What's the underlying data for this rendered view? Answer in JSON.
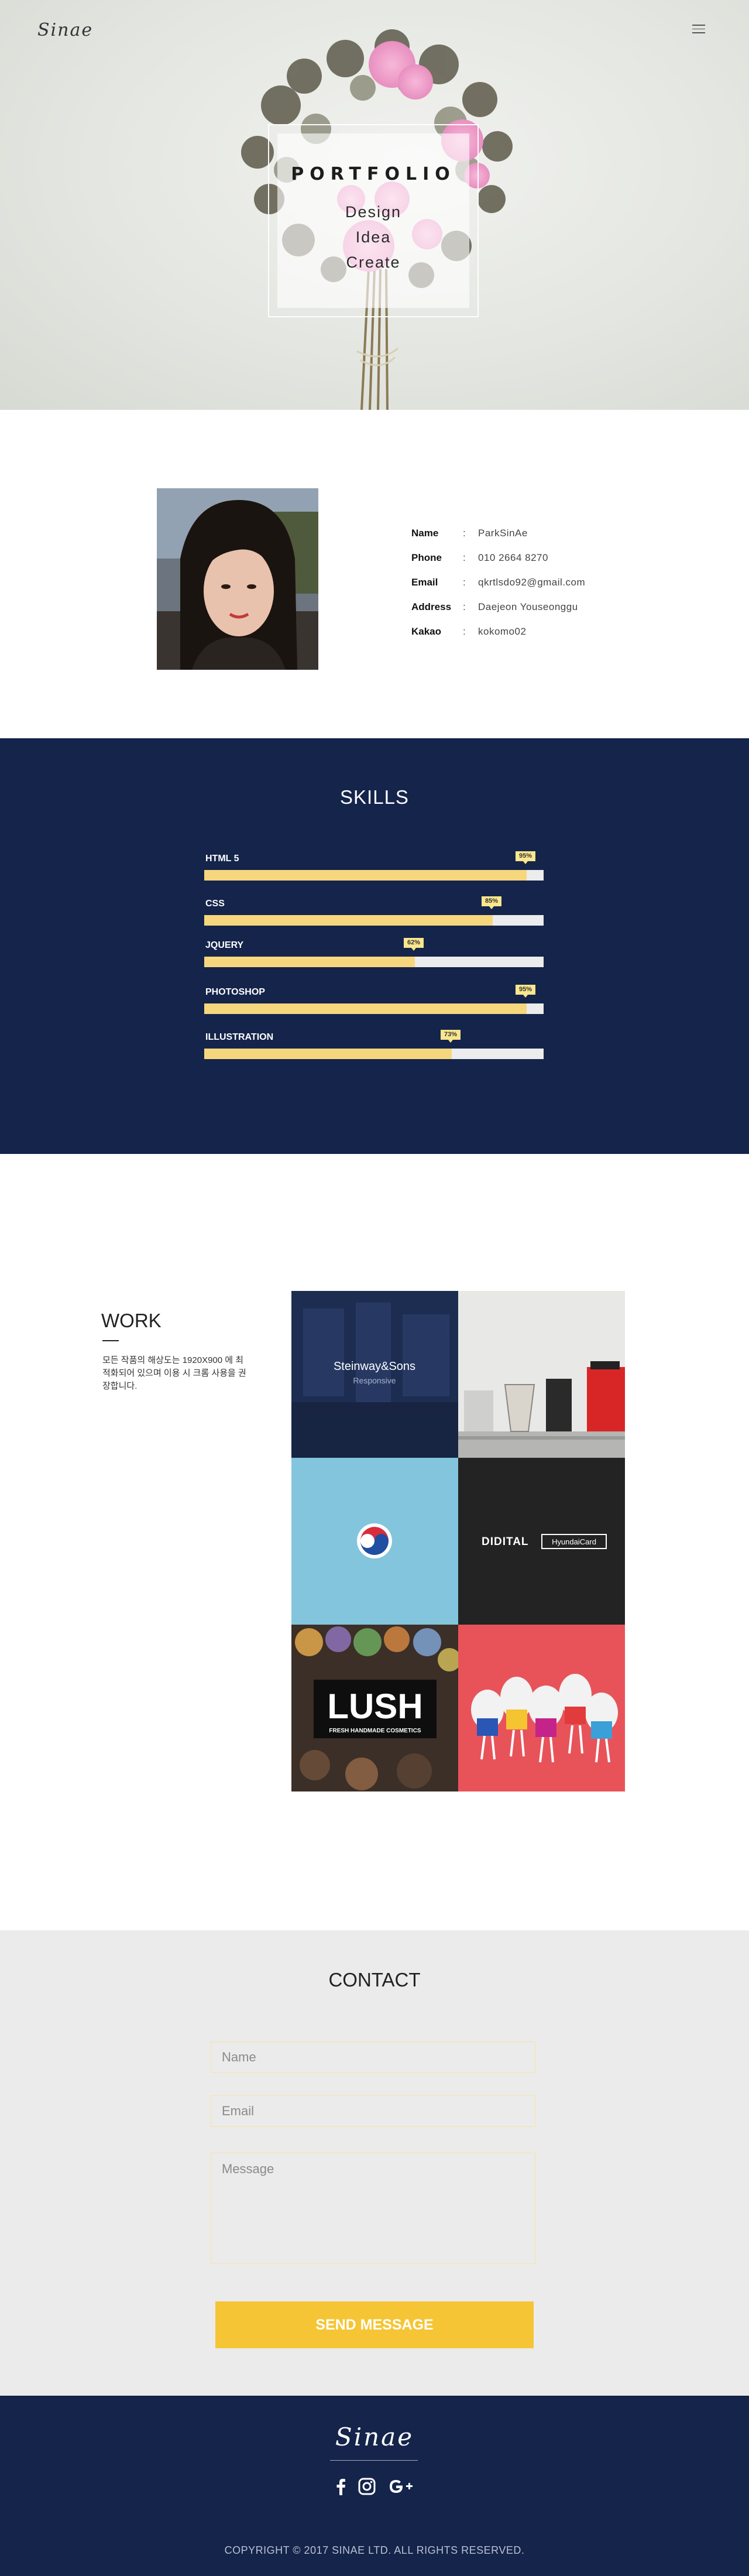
{
  "header": {
    "logo": "Sinae",
    "menu_icon": "hamburger-menu-icon"
  },
  "hero": {
    "title": "PORTFOLIO",
    "words": [
      "Design",
      "Idea",
      "Create"
    ]
  },
  "profile": {
    "rows": [
      {
        "key": "Name",
        "value": "ParkSinAe"
      },
      {
        "key": "Phone",
        "value": "010 2664 8270"
      },
      {
        "key": "Email",
        "value": "qkrtlsdo92@gmail.com"
      },
      {
        "key": "Address",
        "value": "Daejeon Youseonggu"
      },
      {
        "key": "Kakao",
        "value": "kokomo02"
      }
    ],
    "colon": ":"
  },
  "skills": {
    "title": "SKILLS",
    "items": [
      {
        "name": "HTML 5",
        "percent": 95,
        "label": "95%"
      },
      {
        "name": "CSS",
        "percent": 85,
        "label": "85%"
      },
      {
        "name": "JQUERY",
        "percent": 62,
        "label": "62%"
      },
      {
        "name": "PHOTOSHOP",
        "percent": 95,
        "label": "95%"
      },
      {
        "name": "ILLUSTRATION",
        "percent": 73,
        "label": "73%"
      }
    ],
    "colors": {
      "fill": "#f7d77d",
      "track": "#ececec",
      "background": "#14244b"
    }
  },
  "work": {
    "title": "WORK",
    "description": "모든 작품의 해상도는 1920X900 에 최적화되어 있으며 이용 시 크롬 사용을 권장합니다.",
    "tiles": [
      {
        "title": "Steinway&Sons",
        "subtitle": "Responsive"
      },
      {
        "title": ""
      },
      {
        "title": ""
      },
      {
        "title": "DIDITAL",
        "badge": "HyundaiCard"
      },
      {
        "title": "LUSH",
        "subtitle": "FRESH HANDMADE COSMETICS"
      },
      {
        "title": ""
      }
    ]
  },
  "contact": {
    "title": "CONTACT",
    "name_placeholder": "Name",
    "email_placeholder": "Email",
    "message_placeholder": "Message",
    "send_label": "SEND MESSAGE"
  },
  "footer": {
    "logo": "Sinae",
    "social_icons": [
      "facebook-icon",
      "instagram-icon",
      "google-plus-icon"
    ],
    "copyright": "COPYRIGHT © 2017 SINAE LTD. ALL RIGHTS RESERVED."
  }
}
